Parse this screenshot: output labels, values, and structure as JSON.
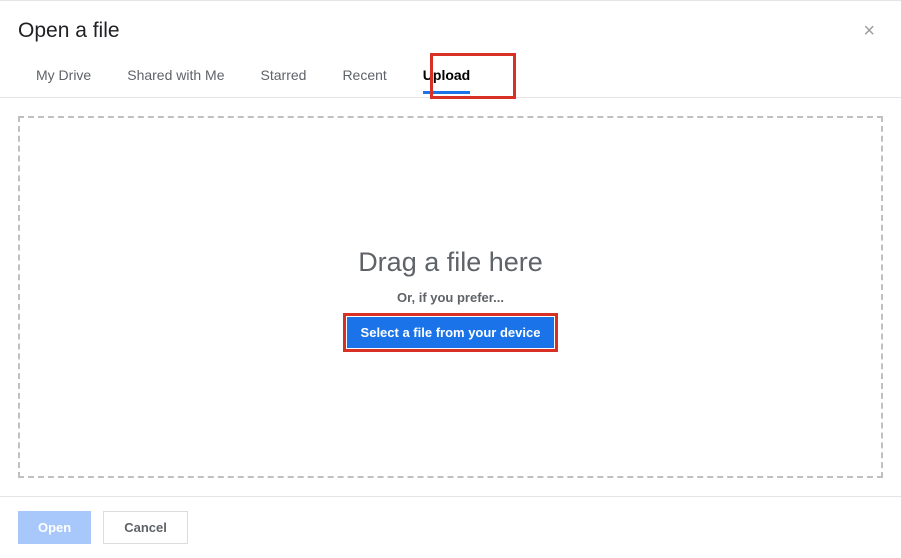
{
  "dialog": {
    "title": "Open a file"
  },
  "tabs": {
    "my_drive": "My Drive",
    "shared": "Shared with Me",
    "starred": "Starred",
    "recent": "Recent",
    "upload": "Upload"
  },
  "upload": {
    "drag_text": "Drag a file here",
    "or_text": "Or, if you prefer...",
    "select_label": "Select a file from your device"
  },
  "footer": {
    "open_label": "Open",
    "cancel_label": "Cancel"
  }
}
